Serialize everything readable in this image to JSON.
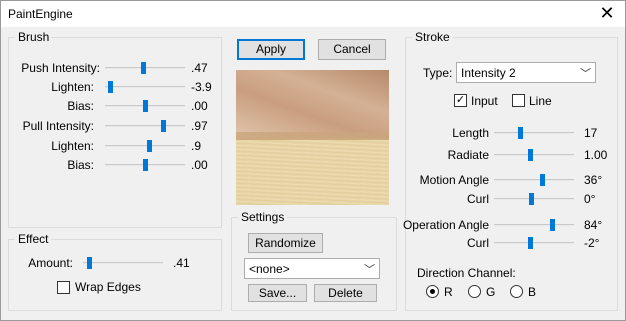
{
  "window": {
    "title": "PaintEngine"
  },
  "brush": {
    "legend": "Brush",
    "rows": [
      {
        "label": "Push Intensity:",
        "value": ".47",
        "pos": 0.47
      },
      {
        "label": "Lighten:",
        "value": "-3.9",
        "pos": 0.06
      },
      {
        "label": "Bias:",
        "value": ".00",
        "pos": 0.5
      },
      {
        "label": "Pull Intensity:",
        "value": ".97",
        "pos": 0.73
      },
      {
        "label": "Lighten:",
        "value": ".9",
        "pos": 0.55
      },
      {
        "label": "Bias:",
        "value": ".00",
        "pos": 0.5
      }
    ]
  },
  "effect": {
    "legend": "Effect",
    "amount_label": "Amount:",
    "amount_value": ".41",
    "amount_pos": 0.07,
    "wrap_edges_label": "Wrap Edges",
    "wrap_edges_checked": false
  },
  "buttons": {
    "apply": "Apply",
    "cancel": "Cancel"
  },
  "settings": {
    "legend": "Settings",
    "randomize": "Randomize",
    "preset": "<none>",
    "save": "Save...",
    "delete": "Delete"
  },
  "stroke": {
    "legend": "Stroke",
    "type_label": "Type:",
    "type_value": "Intensity 2",
    "input_label": "Input",
    "input_checked": true,
    "line_label": "Line",
    "line_checked": false,
    "rows": [
      {
        "label": "Length",
        "value": "17",
        "pos": 0.32
      },
      {
        "label": "Radiate",
        "value": "1.00",
        "pos": 0.45
      },
      {
        "label": "Motion Angle",
        "value": "36°",
        "pos": 0.6
      },
      {
        "label": "Curl",
        "value": "0°",
        "pos": 0.46
      },
      {
        "label": "Operation Angle",
        "value": "84°",
        "pos": 0.73
      },
      {
        "label": "Curl",
        "value": "-2°",
        "pos": 0.45
      }
    ],
    "direction_label": "Direction Channel:",
    "channels": [
      {
        "label": "R",
        "selected": true
      },
      {
        "label": "G",
        "selected": false
      },
      {
        "label": "B",
        "selected": false
      }
    ]
  },
  "colors": {
    "accent": "#0078d7",
    "background": "#f0f0f0"
  }
}
